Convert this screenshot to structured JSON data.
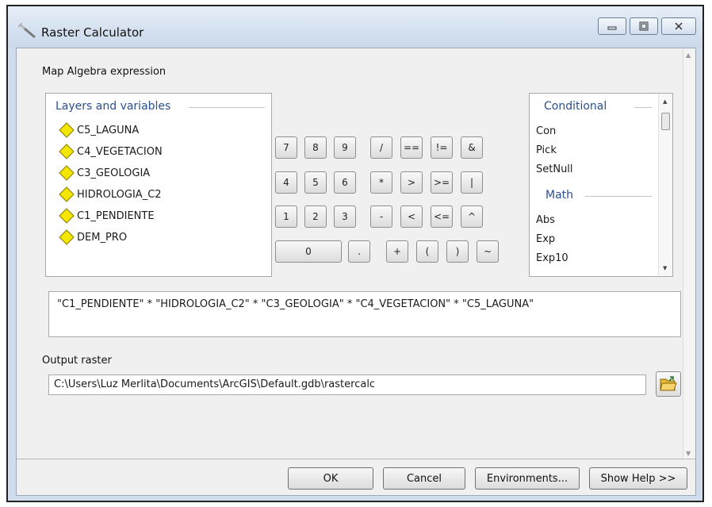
{
  "window": {
    "title": "Raster Calculator",
    "app_icon": "calculator-wand-icon",
    "controls": {
      "minimize": "minimize-icon",
      "maximize": "maximize-icon",
      "close": "close-icon"
    }
  },
  "map_algebra": {
    "label": "Map Algebra expression",
    "layers_heading": "Layers and variables",
    "layers": [
      "C5_LAGUNA",
      "C4_VEGETACION",
      "C3_GEOLOGIA",
      "HIDROLOGIA_C2",
      "C1_PENDIENTE",
      "DEM_PRO"
    ],
    "layer_icon": "raster-layer-diamond-icon",
    "layer_icon_color": "#f3e600",
    "buttons": {
      "b7": "7",
      "b8": "8",
      "b9": "9",
      "div": "/",
      "eq": "==",
      "neq": "!=",
      "and": "&",
      "b4": "4",
      "b5": "5",
      "b6": "6",
      "mul": "*",
      "gt": ">",
      "gte": ">=",
      "or": "|",
      "b1": "1",
      "b2": "2",
      "b3": "3",
      "sub": "-",
      "lt": "<",
      "lte": "<=",
      "xor": "^",
      "b0": "0",
      "dot": ".",
      "add": "+",
      "lparen": "(",
      "rparen": ")",
      "not": "~"
    },
    "functions": {
      "conditional_heading": "Conditional",
      "conditional": [
        "Con",
        "Pick",
        "SetNull"
      ],
      "math_heading": "Math",
      "math": [
        "Abs",
        "Exp",
        "Exp10"
      ]
    },
    "expression": "\"C1_PENDIENTE\" * \"HIDROLOGIA_C2\" * \"C3_GEOLOGIA\" * \"C4_VEGETACION\" * \"C5_LAGUNA\""
  },
  "output": {
    "label": "Output raster",
    "value": "C:\\Users\\Luz Merlita\\Documents\\ArcGIS\\Default.gdb\\rastercalc",
    "browse_icon": "open-folder-icon"
  },
  "footer": {
    "ok": "OK",
    "cancel": "Cancel",
    "environments": "Environments...",
    "show_help": "Show Help >>"
  },
  "colors": {
    "heading_blue": "#2c4f8f",
    "title_bar": "#cfdcec",
    "dialog_bg": "#f0f0f0"
  }
}
